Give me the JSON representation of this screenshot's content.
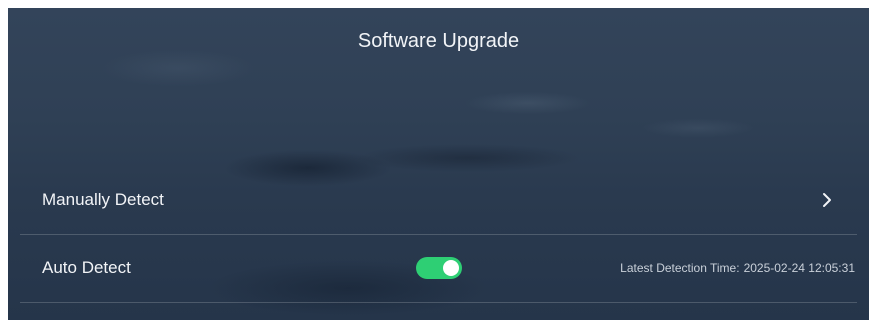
{
  "header": {
    "title": "Software Upgrade"
  },
  "rows": {
    "manual": {
      "label": "Manually Detect",
      "icon": "chevron-right-icon"
    },
    "auto": {
      "label": "Auto Detect",
      "toggle_state": "on",
      "toggle_color": "#2ecf74",
      "latest_label": "Latest Detection Time:",
      "latest_value": "2025-02-24 12:05:31"
    }
  }
}
